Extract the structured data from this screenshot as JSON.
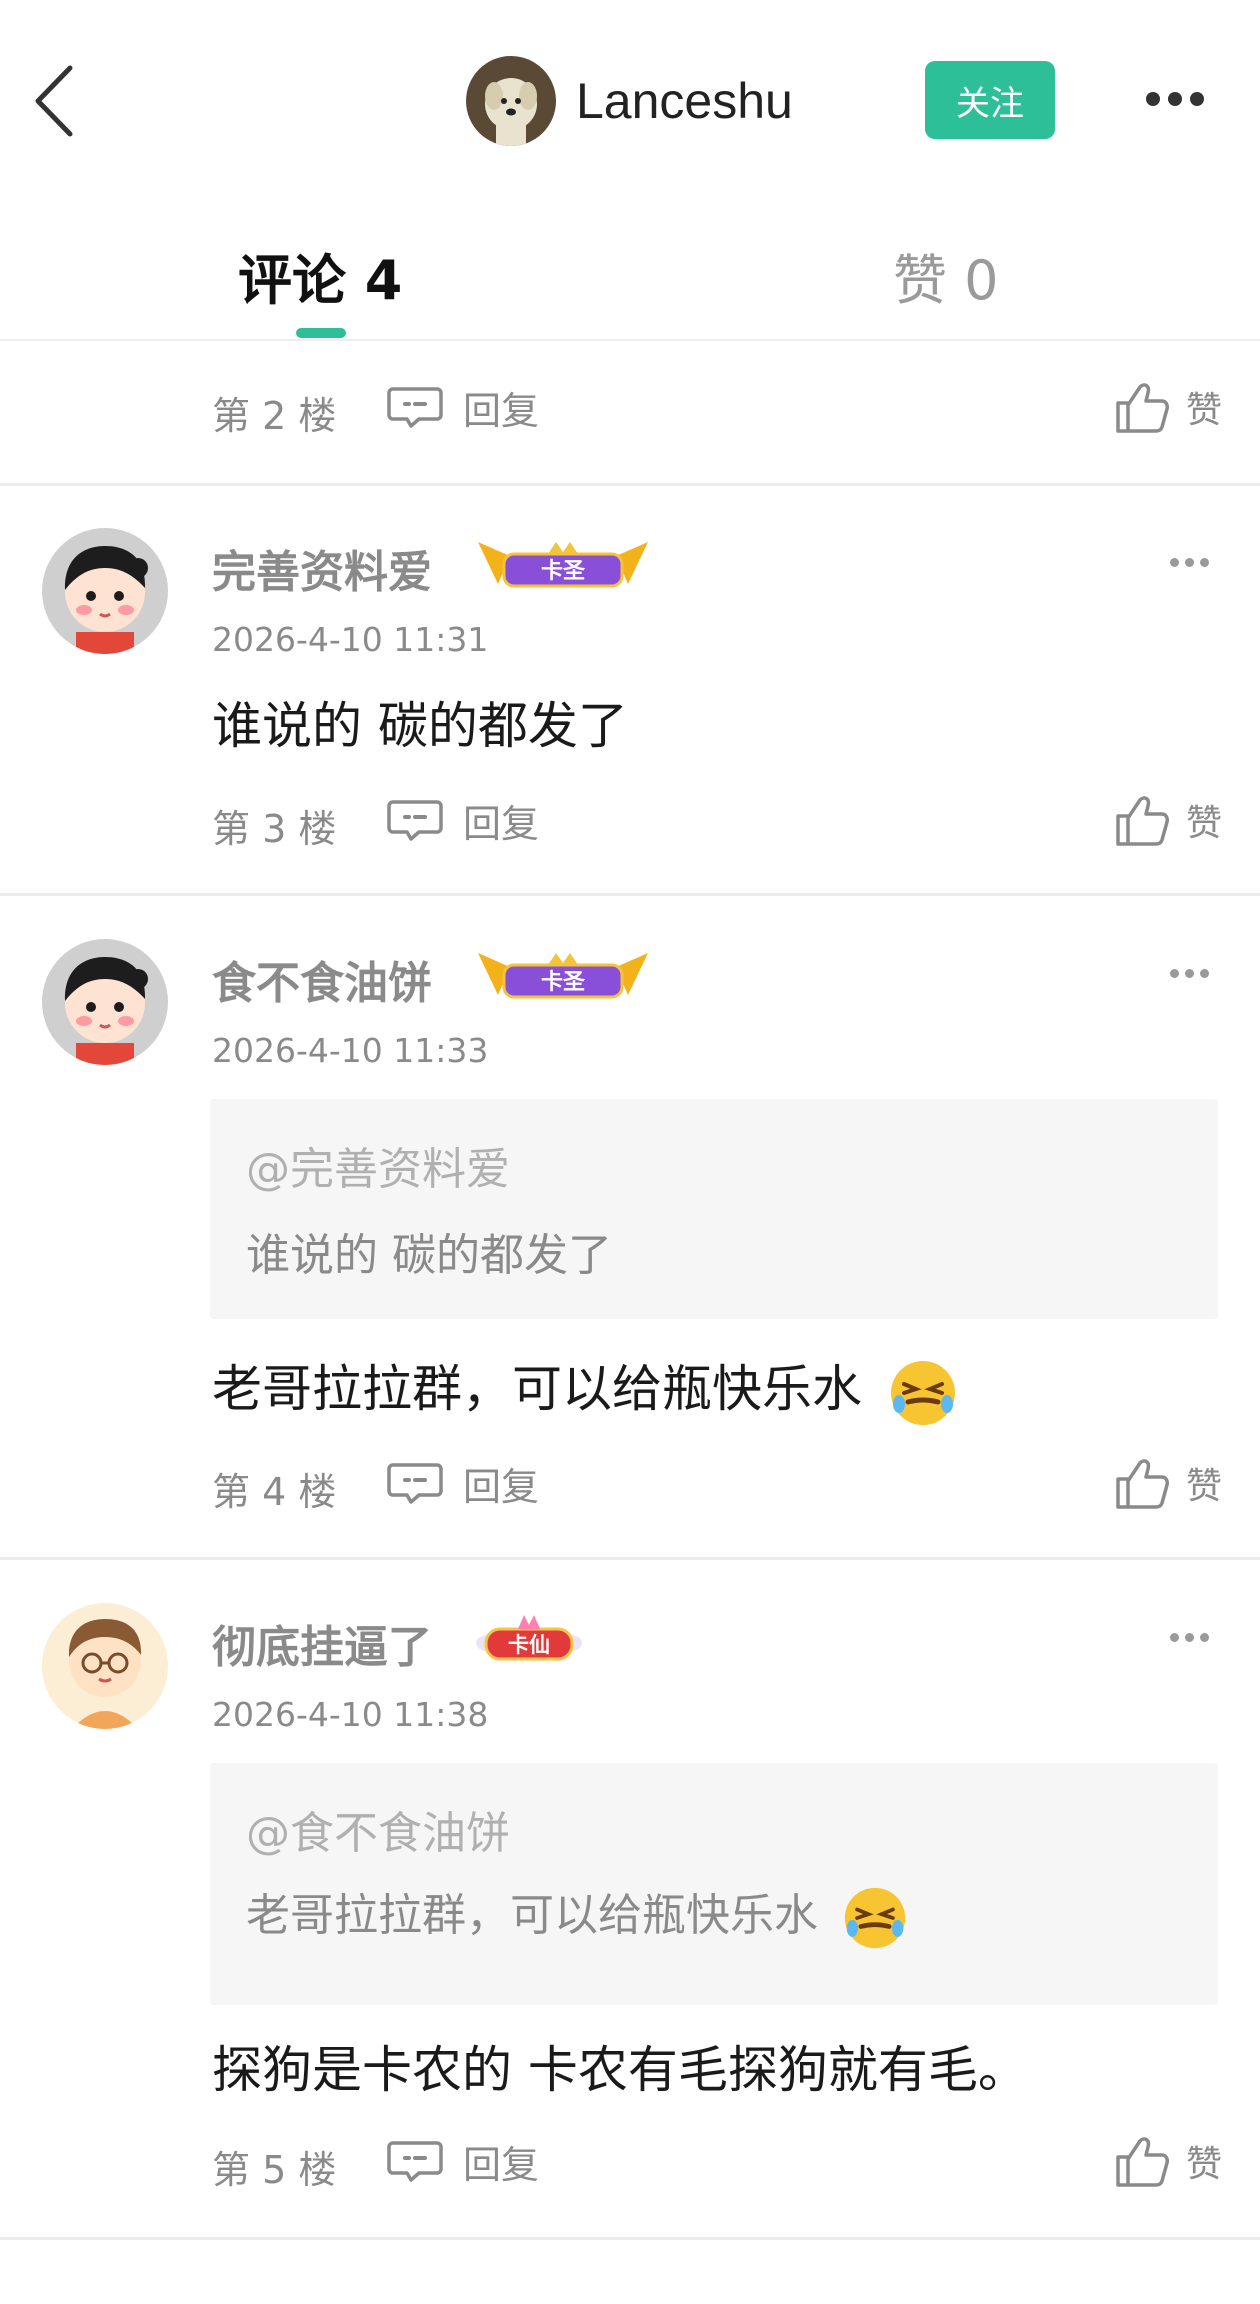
{
  "header": {
    "username": "Lanceshu",
    "follow_label": "关注"
  },
  "tabs": {
    "comments_label": "评论 4",
    "likes_label": "赞 0"
  },
  "floor2": {
    "floor_label": "第 2 楼",
    "reply_label": "回复",
    "like_label": "赞"
  },
  "comments": [
    {
      "username": "完善资料爱",
      "badge": "卡圣",
      "time": "2026-4-10 11:31",
      "text": "谁说的 碳的都发了",
      "floor_label": "第 3 楼",
      "reply_label": "回复",
      "like_label": "赞"
    },
    {
      "username": "食不食油饼",
      "badge": "卡圣",
      "time": "2026-4-10 11:33",
      "quote_at": "@完善资料爱",
      "quote_text": "谁说的 碳的都发了",
      "text": "老哥拉拉群，可以给瓶快乐水",
      "floor_label": "第 4 楼",
      "reply_label": "回复",
      "like_label": "赞"
    },
    {
      "username": "彻底挂逼了",
      "badge": "卡仙",
      "time": "2026-4-10 11:38",
      "quote_at": "@食不食油饼",
      "quote_text": "老哥拉拉群，可以给瓶快乐水",
      "text": "探狗是卡农的 卡农有毛探狗就有毛。",
      "floor_label": "第 5 楼",
      "reply_label": "回复",
      "like_label": "赞"
    }
  ],
  "colors": {
    "accent": "#2dbf98",
    "muted_text": "#8a8a8a",
    "badge_purple": "#8a4fd8",
    "badge_red": "#e23a3a"
  }
}
